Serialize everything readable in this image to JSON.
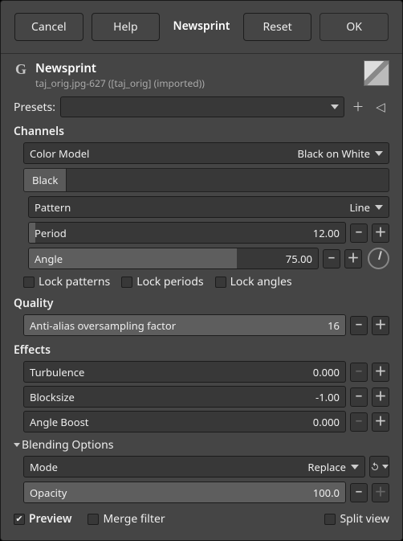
{
  "buttons": {
    "cancel": "Cancel",
    "help": "Help",
    "crumb": "Newsprint",
    "reset": "Reset",
    "ok": "OK"
  },
  "header": {
    "title": "Newsprint",
    "subtitle": "taj_orig.jpg-627 ([taj_orig] (imported))"
  },
  "presets": {
    "label": "Presets:"
  },
  "channels": {
    "label": "Channels",
    "colorModel": {
      "name": "Color Model",
      "value": "Black on White"
    },
    "tab": "Black",
    "pattern": {
      "name": "Pattern",
      "value": "Line"
    },
    "period": {
      "name": "Period",
      "value": "12.00"
    },
    "angle": {
      "name": "Angle",
      "value": "75.00"
    },
    "locks": {
      "patterns": "Lock patterns",
      "periods": "Lock periods",
      "angles": "Lock angles"
    }
  },
  "quality": {
    "label": "Quality",
    "aa": {
      "name": "Anti-alias oversampling factor",
      "value": "16"
    }
  },
  "effects": {
    "label": "Effects",
    "turbulence": {
      "name": "Turbulence",
      "value": "0.000"
    },
    "blocksize": {
      "name": "Blocksize",
      "value": "-1.00"
    },
    "angleBoost": {
      "name": "Angle Boost",
      "value": "0.000"
    }
  },
  "blending": {
    "label": "Blending Options",
    "mode": {
      "name": "Mode",
      "value": "Replace"
    },
    "opacity": {
      "name": "Opacity",
      "value": "100.0"
    }
  },
  "footer": {
    "preview": "Preview",
    "merge": "Merge filter",
    "split": "Split view"
  }
}
